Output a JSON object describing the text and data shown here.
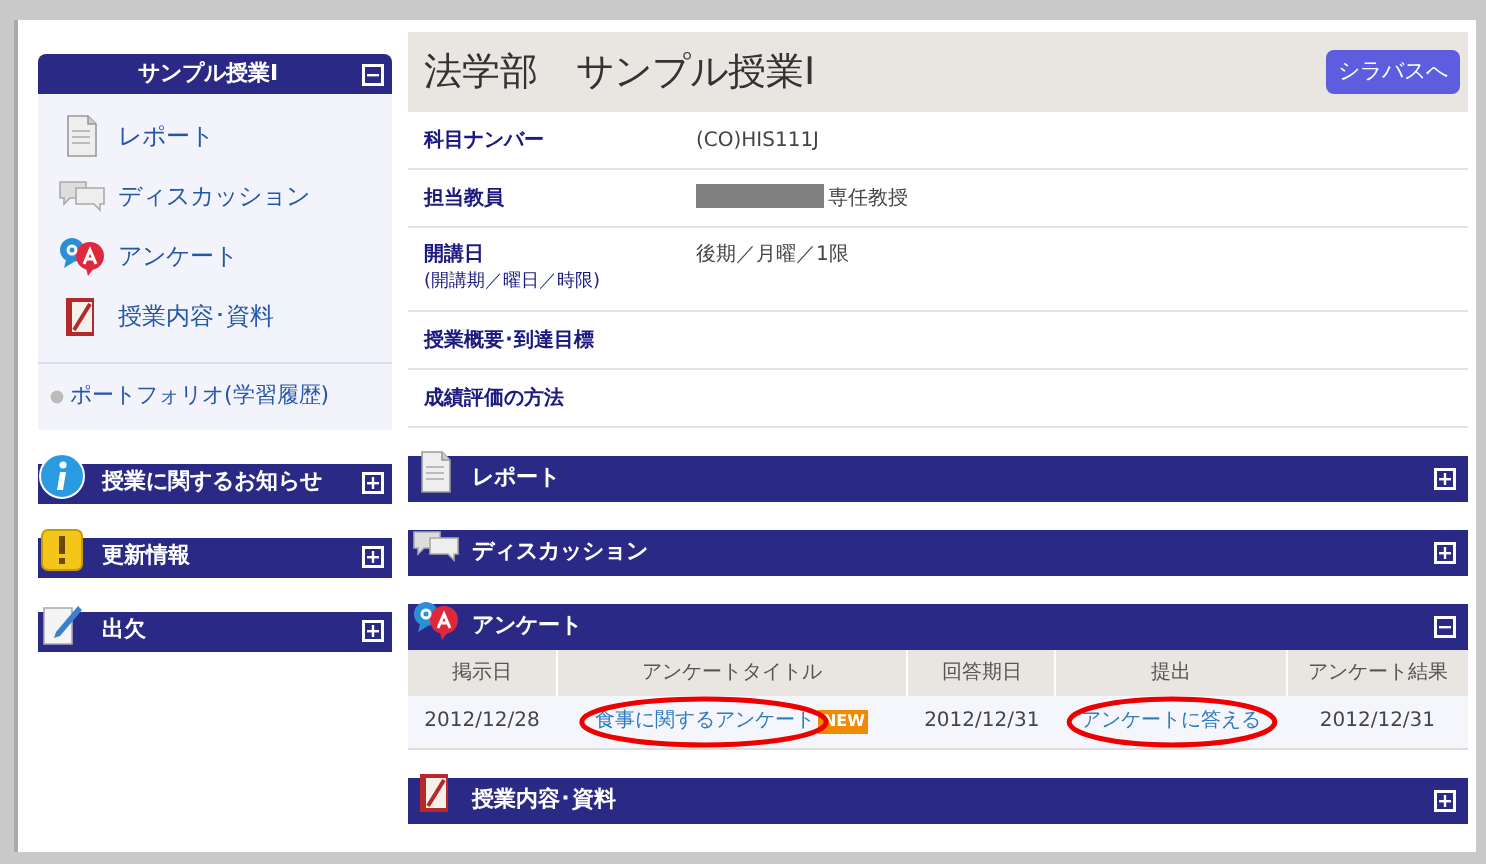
{
  "sidebar": {
    "course_panel": {
      "title": "サンプル授業Ⅰ",
      "expanded": true,
      "items": [
        {
          "label": "レポート",
          "kind": "report"
        },
        {
          "label": "ディスカッション",
          "kind": "discussion"
        },
        {
          "label": "アンケート",
          "kind": "survey"
        },
        {
          "label": "授業内容･資料",
          "kind": "materials"
        }
      ],
      "portfolio_link": "ポートフォリオ(学習履歴)"
    },
    "panels": [
      {
        "title": "授業に関するお知らせ",
        "kind": "info",
        "expanded": false
      },
      {
        "title": "更新情報",
        "kind": "updates",
        "expanded": false
      },
      {
        "title": "出欠",
        "kind": "attendance",
        "expanded": false
      }
    ]
  },
  "course": {
    "title": "法学部　サンプル授業Ⅰ",
    "syllabus_button": "シラバスへ",
    "fields": [
      {
        "label": "科目ナンバー",
        "value": "(CO)HIS111J"
      },
      {
        "label": "担当教員",
        "value": "専任教授",
        "redacted": true
      },
      {
        "label": "開講日",
        "sublabel": "(開講期／曜日／時限)",
        "value": "後期／月曜／1限"
      },
      {
        "label": "授業概要･到達目標"
      },
      {
        "label": "成績評価の方法"
      }
    ]
  },
  "sections": [
    {
      "title": "レポート",
      "kind": "report",
      "expanded": false
    },
    {
      "title": "ディスカッション",
      "kind": "discussion",
      "expanded": false
    },
    {
      "title": "アンケート",
      "kind": "survey",
      "expanded": true,
      "table": {
        "columns": [
          "掲示日",
          "アンケートタイトル",
          "回答期日",
          "提出",
          "アンケート結果"
        ],
        "rows": [
          {
            "posted": "2012/12/28",
            "title": {
              "text": "食事に関するアンケート",
              "circled": true
            },
            "badge": "NEW",
            "due": "2012/12/31",
            "submit": {
              "text": "アンケートに答える",
              "circled": true
            },
            "result": "2012/12/31"
          }
        ]
      }
    },
    {
      "title": "授業内容･資料",
      "kind": "materials",
      "expanded": false
    }
  ]
}
